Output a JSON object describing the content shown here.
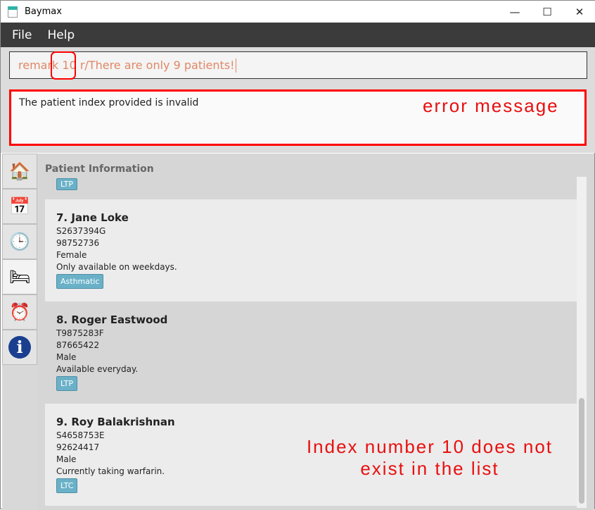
{
  "window": {
    "title": "Baymax",
    "minimize": "—",
    "maximize": "☐",
    "close": "✕"
  },
  "menu": [
    "File",
    "Help"
  ],
  "command": {
    "value": "remark 10 r/There are only 9 patients!"
  },
  "result": {
    "text": "The patient index provided is invalid"
  },
  "annotations": {
    "error": "error message",
    "index": "Index number 10 does not exist in the list"
  },
  "sidebar": [
    {
      "icon": "home-icon",
      "glyph": "🏠"
    },
    {
      "icon": "calendar-icon",
      "glyph": "📅"
    },
    {
      "icon": "clock-24h-icon",
      "glyph": "🕒"
    },
    {
      "icon": "patient-icon",
      "glyph": "🛏"
    },
    {
      "icon": "appointment-icon",
      "glyph": "⏰"
    },
    {
      "icon": "info-icon",
      "glyph": "ℹ"
    }
  ],
  "panel": {
    "title": "Patient Information",
    "prev_tag": "LTP"
  },
  "patients": [
    {
      "name": "7.  Jane Loke",
      "nric": "S2637394G",
      "phone": "98752736",
      "gender": "Female",
      "remark": "Only available on weekdays.",
      "tag": "Asthmatic"
    },
    {
      "name": "8.  Roger Eastwood",
      "nric": "T9875283F",
      "phone": "87665422",
      "gender": "Male",
      "remark": "Available everyday.",
      "tag": "LTP"
    },
    {
      "name": "9.  Roy Balakrishnan",
      "nric": "S4658753E",
      "phone": "92624417",
      "gender": "Male",
      "remark": "Currently taking warfarin.",
      "tag": "LTC"
    }
  ],
  "colors": {
    "error": "#ff0000",
    "tag": "#6ab1c8",
    "command_text": "#e08866"
  }
}
